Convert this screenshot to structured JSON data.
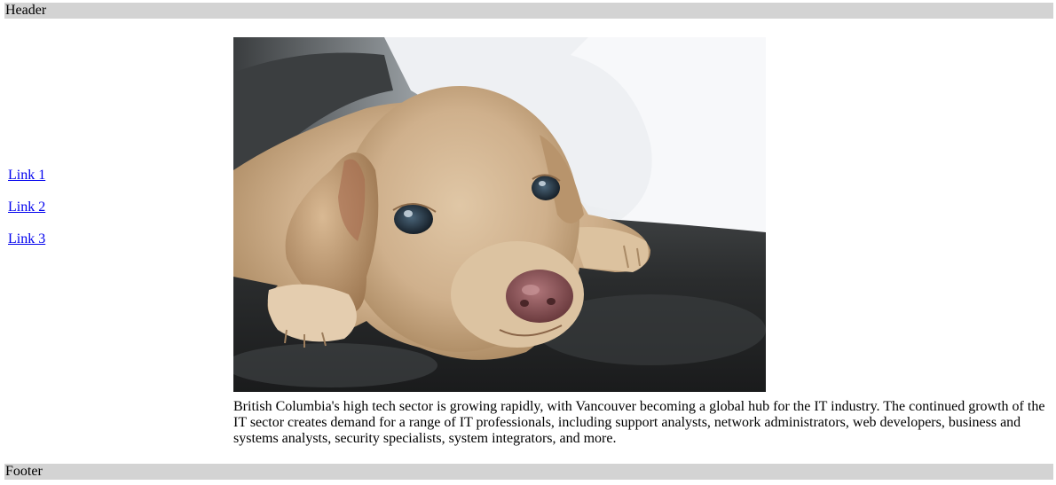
{
  "header": {
    "label": "Header"
  },
  "nav": {
    "links": [
      {
        "label": "Link 1"
      },
      {
        "label": "Link 2"
      },
      {
        "label": "Link 3"
      }
    ]
  },
  "main": {
    "image": {
      "icon": "puppy-photo"
    },
    "paragraph": "British Columbia's high tech sector is growing rapidly, with Vancouver becoming a global hub for the IT industry. The continued growth of the IT sector creates demand for a range of IT professionals, including support analysts, network administrators, web developers, business and systems analysts, security specialists, system integrators, and more."
  },
  "footer": {
    "label": "Footer"
  },
  "colors": {
    "bar_background": "#d3d3d3",
    "link": "#0000ee"
  }
}
